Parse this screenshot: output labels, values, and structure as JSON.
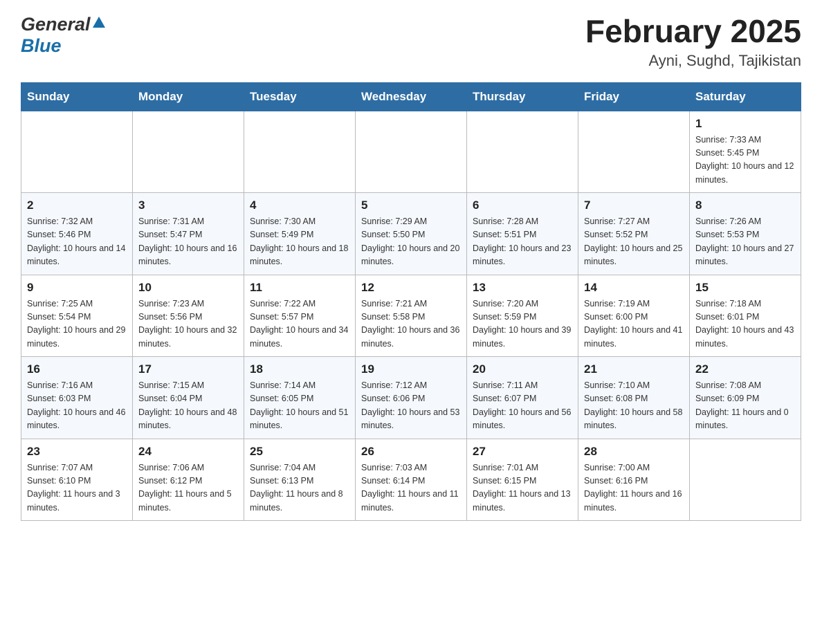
{
  "header": {
    "logo_general": "General",
    "logo_blue": "Blue",
    "month_title": "February 2025",
    "location": "Ayni, Sughd, Tajikistan"
  },
  "weekdays": [
    "Sunday",
    "Monday",
    "Tuesday",
    "Wednesday",
    "Thursday",
    "Friday",
    "Saturday"
  ],
  "weeks": [
    [
      {
        "day": "",
        "info": ""
      },
      {
        "day": "",
        "info": ""
      },
      {
        "day": "",
        "info": ""
      },
      {
        "day": "",
        "info": ""
      },
      {
        "day": "",
        "info": ""
      },
      {
        "day": "",
        "info": ""
      },
      {
        "day": "1",
        "info": "Sunrise: 7:33 AM\nSunset: 5:45 PM\nDaylight: 10 hours and 12 minutes."
      }
    ],
    [
      {
        "day": "2",
        "info": "Sunrise: 7:32 AM\nSunset: 5:46 PM\nDaylight: 10 hours and 14 minutes."
      },
      {
        "day": "3",
        "info": "Sunrise: 7:31 AM\nSunset: 5:47 PM\nDaylight: 10 hours and 16 minutes."
      },
      {
        "day": "4",
        "info": "Sunrise: 7:30 AM\nSunset: 5:49 PM\nDaylight: 10 hours and 18 minutes."
      },
      {
        "day": "5",
        "info": "Sunrise: 7:29 AM\nSunset: 5:50 PM\nDaylight: 10 hours and 20 minutes."
      },
      {
        "day": "6",
        "info": "Sunrise: 7:28 AM\nSunset: 5:51 PM\nDaylight: 10 hours and 23 minutes."
      },
      {
        "day": "7",
        "info": "Sunrise: 7:27 AM\nSunset: 5:52 PM\nDaylight: 10 hours and 25 minutes."
      },
      {
        "day": "8",
        "info": "Sunrise: 7:26 AM\nSunset: 5:53 PM\nDaylight: 10 hours and 27 minutes."
      }
    ],
    [
      {
        "day": "9",
        "info": "Sunrise: 7:25 AM\nSunset: 5:54 PM\nDaylight: 10 hours and 29 minutes."
      },
      {
        "day": "10",
        "info": "Sunrise: 7:23 AM\nSunset: 5:56 PM\nDaylight: 10 hours and 32 minutes."
      },
      {
        "day": "11",
        "info": "Sunrise: 7:22 AM\nSunset: 5:57 PM\nDaylight: 10 hours and 34 minutes."
      },
      {
        "day": "12",
        "info": "Sunrise: 7:21 AM\nSunset: 5:58 PM\nDaylight: 10 hours and 36 minutes."
      },
      {
        "day": "13",
        "info": "Sunrise: 7:20 AM\nSunset: 5:59 PM\nDaylight: 10 hours and 39 minutes."
      },
      {
        "day": "14",
        "info": "Sunrise: 7:19 AM\nSunset: 6:00 PM\nDaylight: 10 hours and 41 minutes."
      },
      {
        "day": "15",
        "info": "Sunrise: 7:18 AM\nSunset: 6:01 PM\nDaylight: 10 hours and 43 minutes."
      }
    ],
    [
      {
        "day": "16",
        "info": "Sunrise: 7:16 AM\nSunset: 6:03 PM\nDaylight: 10 hours and 46 minutes."
      },
      {
        "day": "17",
        "info": "Sunrise: 7:15 AM\nSunset: 6:04 PM\nDaylight: 10 hours and 48 minutes."
      },
      {
        "day": "18",
        "info": "Sunrise: 7:14 AM\nSunset: 6:05 PM\nDaylight: 10 hours and 51 minutes."
      },
      {
        "day": "19",
        "info": "Sunrise: 7:12 AM\nSunset: 6:06 PM\nDaylight: 10 hours and 53 minutes."
      },
      {
        "day": "20",
        "info": "Sunrise: 7:11 AM\nSunset: 6:07 PM\nDaylight: 10 hours and 56 minutes."
      },
      {
        "day": "21",
        "info": "Sunrise: 7:10 AM\nSunset: 6:08 PM\nDaylight: 10 hours and 58 minutes."
      },
      {
        "day": "22",
        "info": "Sunrise: 7:08 AM\nSunset: 6:09 PM\nDaylight: 11 hours and 0 minutes."
      }
    ],
    [
      {
        "day": "23",
        "info": "Sunrise: 7:07 AM\nSunset: 6:10 PM\nDaylight: 11 hours and 3 minutes."
      },
      {
        "day": "24",
        "info": "Sunrise: 7:06 AM\nSunset: 6:12 PM\nDaylight: 11 hours and 5 minutes."
      },
      {
        "day": "25",
        "info": "Sunrise: 7:04 AM\nSunset: 6:13 PM\nDaylight: 11 hours and 8 minutes."
      },
      {
        "day": "26",
        "info": "Sunrise: 7:03 AM\nSunset: 6:14 PM\nDaylight: 11 hours and 11 minutes."
      },
      {
        "day": "27",
        "info": "Sunrise: 7:01 AM\nSunset: 6:15 PM\nDaylight: 11 hours and 13 minutes."
      },
      {
        "day": "28",
        "info": "Sunrise: 7:00 AM\nSunset: 6:16 PM\nDaylight: 11 hours and 16 minutes."
      },
      {
        "day": "",
        "info": ""
      }
    ]
  ]
}
